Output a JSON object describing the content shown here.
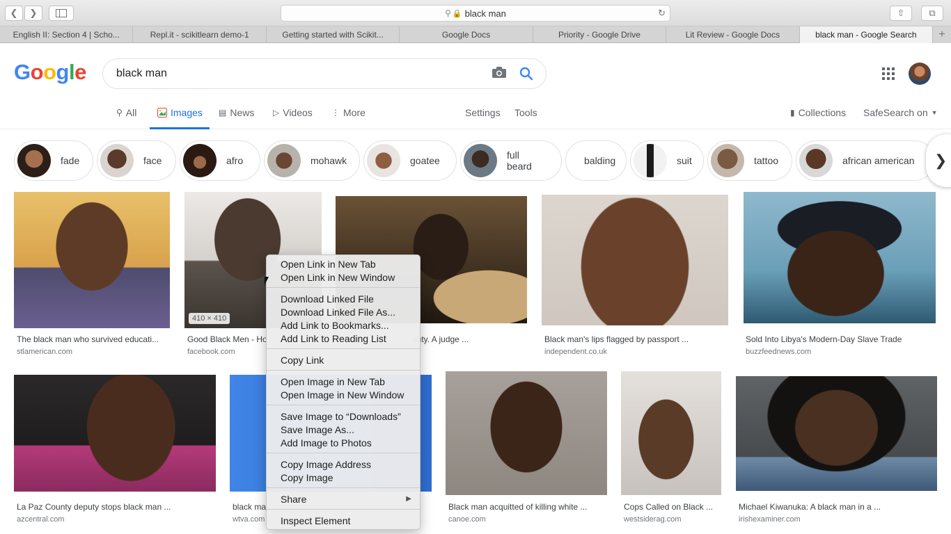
{
  "browser": {
    "address": "black man",
    "tabs": [
      {
        "label": "English II: Section 4 | Scho..."
      },
      {
        "label": "Repl.it - scikitlearn demo-1"
      },
      {
        "label": "Getting started with Scikit..."
      },
      {
        "label": "Google Docs"
      },
      {
        "label": "Priority - Google Drive"
      },
      {
        "label": "Lit Review - Google Docs"
      },
      {
        "label": "black man - Google Search"
      }
    ],
    "new_tab": "+"
  },
  "google": {
    "logo": [
      "G",
      "o",
      "o",
      "g",
      "l",
      "e"
    ],
    "query": "black man",
    "nav": {
      "all": "All",
      "images": "Images",
      "news": "News",
      "videos": "Videos",
      "more": "More",
      "settings": "Settings",
      "tools": "Tools",
      "collections": "Collections",
      "safesearch": "SafeSearch on"
    },
    "chips": [
      {
        "label": "fade"
      },
      {
        "label": "face"
      },
      {
        "label": "afro"
      },
      {
        "label": "mohawk"
      },
      {
        "label": "goatee"
      },
      {
        "label": "full beard"
      },
      {
        "label": "balding"
      },
      {
        "label": "suit"
      },
      {
        "label": "tattoo"
      },
      {
        "label": "african american"
      }
    ],
    "results": [
      {
        "title": "The black man who survived educati...",
        "source": "stlamerican.com"
      },
      {
        "title": "Good Black Men - Ho",
        "source": "facebook.com",
        "dims": "410 × 410"
      },
      {
        "title": "duty. A judge ...",
        "source": ""
      },
      {
        "title": "Black man's lips flagged by passport ...",
        "source": "independent.co.uk"
      },
      {
        "title": "Sold Into Libya's Modern-Day Slave Trade",
        "source": "buzzfeednews.com"
      },
      {
        "title": "La Paz County deputy stops black man ...",
        "source": "azcentral.com"
      },
      {
        "title": "black ma",
        "source": "wtva.com"
      },
      {
        "title": "Black man acquitted of killing white ...",
        "source": "canoe.com"
      },
      {
        "title": "Cops Called on Black ...",
        "source": "westsiderag.com"
      },
      {
        "title": "Michael Kiwanuka: A black man in a ...",
        "source": "irishexaminer.com"
      }
    ]
  },
  "context_menu": {
    "items": [
      "Open Link in New Tab",
      "Open Link in New Window",
      "Download Linked File",
      "Download Linked File As...",
      "Add Link to Bookmarks...",
      "Add Link to Reading List",
      "Copy Link",
      "Open Image in New Tab",
      "Open Image in New Window",
      "Save Image to “Downloads”",
      "Save Image As...",
      "Add Image to Photos",
      "Copy Image Address",
      "Copy Image",
      "Share",
      "Inspect Element"
    ],
    "submenu_arrow": "▶"
  }
}
